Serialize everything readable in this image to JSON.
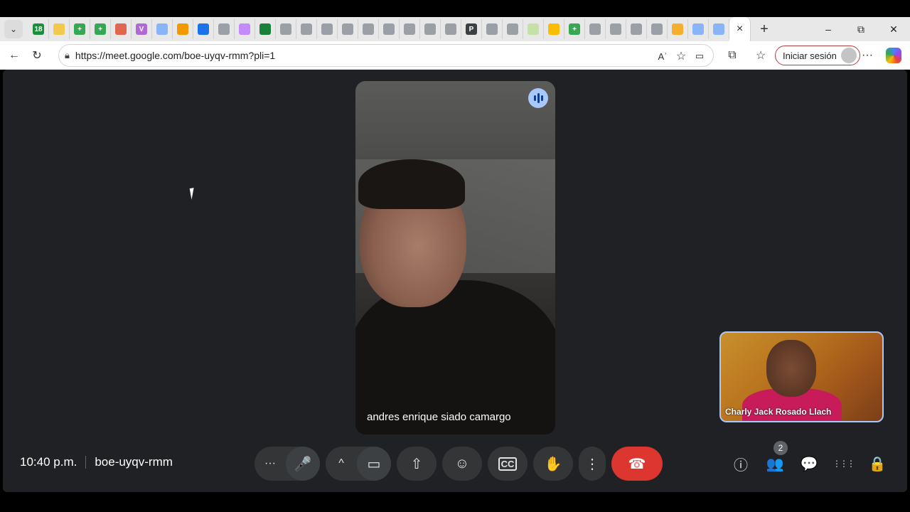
{
  "browser": {
    "tab_dropdown_icon": "chevron-down-icon",
    "tab_favicons": [
      {
        "label": "18",
        "color": "#1e8e3e"
      },
      {
        "label": "",
        "color": "#f2c94c"
      },
      {
        "label": "+",
        "color": "#34a853"
      },
      {
        "label": "+",
        "color": "#34a853"
      },
      {
        "label": "",
        "color": "#e06650"
      },
      {
        "label": "V",
        "color": "#b06ad8"
      },
      {
        "label": "",
        "color": "#8ab4f8"
      },
      {
        "label": "",
        "color": "#f29900"
      },
      {
        "label": "",
        "color": "#1a73e8"
      },
      {
        "label": "",
        "color": "#9aa0a6"
      },
      {
        "label": "",
        "color": "#c58af9"
      },
      {
        "label": "",
        "color": "#188038"
      },
      {
        "label": "",
        "color": "#9aa0a6"
      },
      {
        "label": "",
        "color": "#9aa0a6"
      },
      {
        "label": "",
        "color": "#9aa0a6"
      },
      {
        "label": "",
        "color": "#9aa0a6"
      },
      {
        "label": "",
        "color": "#9aa0a6"
      },
      {
        "label": "",
        "color": "#9aa0a6"
      },
      {
        "label": "",
        "color": "#9aa0a6"
      },
      {
        "label": "",
        "color": "#9aa0a6"
      },
      {
        "label": "",
        "color": "#9aa0a6"
      },
      {
        "label": "P",
        "color": "#3c4043"
      },
      {
        "label": "",
        "color": "#9aa0a6"
      },
      {
        "label": "",
        "color": "#9aa0a6"
      },
      {
        "label": "",
        "color": "#c5e1a5"
      },
      {
        "label": "",
        "color": "#fbbc04"
      },
      {
        "label": "+",
        "color": "#34a853"
      },
      {
        "label": "",
        "color": "#9aa0a6"
      },
      {
        "label": "",
        "color": "#9aa0a6"
      },
      {
        "label": "",
        "color": "#9aa0a6"
      },
      {
        "label": "",
        "color": "#9aa0a6"
      },
      {
        "label": "",
        "color": "#f6ae2d"
      },
      {
        "label": "",
        "color": "#8ab4f8"
      },
      {
        "label": "",
        "color": "#8ab4f8"
      }
    ],
    "active_tab_close": "×",
    "new_tab": "+",
    "window_controls": {
      "minimize": "–",
      "restore": "⧉",
      "close": "✕"
    },
    "nav": {
      "back": "←",
      "reload": "↻"
    },
    "address": {
      "lock_icon": "lock-icon",
      "url": "https://meet.google.com/boe-uyqv-rmm?pli=1"
    },
    "address_right": {
      "read_aloud": "Aʾ",
      "favorite": "☆",
      "camera": "▭"
    },
    "toolbar_right": {
      "extensions": "⧉",
      "favorites": "☆",
      "signin_label": "Iniciar sesión",
      "more": "···",
      "copilot": "copilot-icon"
    }
  },
  "meet": {
    "main_participant": {
      "name": "andres enrique siado camargo",
      "speaking": true
    },
    "self_participant": {
      "name": "Charly Jack Rosado Llach"
    },
    "time": "10:40 p.m.",
    "meeting_code": "boe-uyqv-rmm",
    "controls": {
      "more_audio": "···",
      "mic": "🎤",
      "more_video": "^",
      "camera": "▭",
      "present": "⇧",
      "emoji": "☺",
      "captions": "CC",
      "raise_hand": "✋",
      "more_options": "⋮",
      "end_call": "☎"
    },
    "right_controls": {
      "info": "ⓘ",
      "people": "👥",
      "people_count": "2",
      "chat": "💬",
      "activities": "⋮⋮⋮",
      "host": "🔒"
    }
  }
}
